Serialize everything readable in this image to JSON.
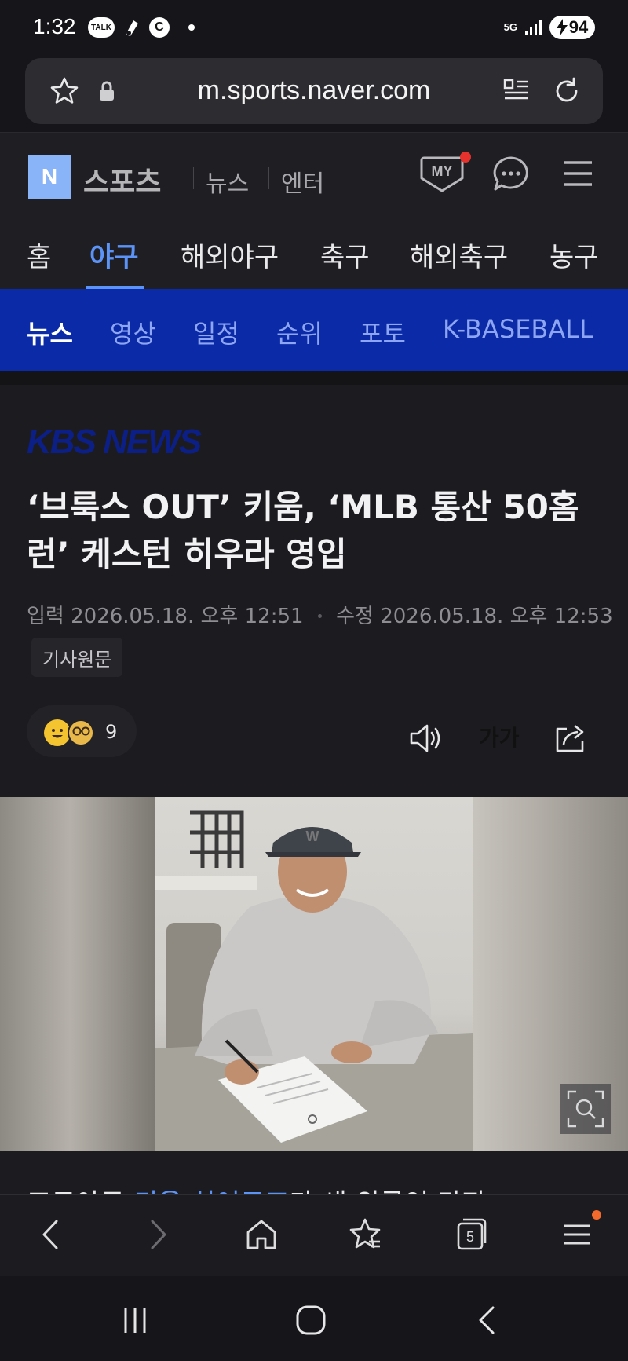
{
  "status_bar": {
    "time": "1:32",
    "talk_badge": "TALK",
    "c_badge": "C",
    "network": "5G",
    "battery": "94"
  },
  "browser": {
    "url": "m.sports.naver.com",
    "tab_count": "5"
  },
  "header": {
    "logo_letter": "N",
    "brand": "스포츠",
    "links": [
      "뉴스",
      "엔터"
    ],
    "my_label": "MY"
  },
  "sport_tabs": [
    "홈",
    "야구",
    "해외야구",
    "축구",
    "해외축구",
    "농구"
  ],
  "active_sport_tab": "야구",
  "sub_nav": [
    "뉴스",
    "영상",
    "일정",
    "순위",
    "포토",
    "K-BASEBALL"
  ],
  "active_sub_nav": "뉴스",
  "article": {
    "press": "KBS NEWS",
    "title_line1": "‘브룩스 OUT’ 키움, ‘MLB 통산 50홈",
    "title_line2": "런’ 케스턴 히우라 영입",
    "input_label": "입력",
    "input_time": "2026.05.18. 오후 12:51",
    "modified_label": "수정",
    "modified_time": "2026.05.18. 오후 12:53",
    "original_button": "기사원문",
    "reaction_count": "9",
    "font_button": "가가",
    "body_peek_prefix": "프로야구 ",
    "body_peek_link": "키움 히어로즈",
    "body_peek_suffix": "가 새 외국인 타자"
  },
  "colors": {
    "accent_blue": "#5c93f7",
    "subnav_bg": "#0b2aa8",
    "notification_red": "#e5322d",
    "menu_badge_orange": "#f36a2d"
  },
  "icons": [
    "star-icon",
    "lock-icon",
    "reader-icon",
    "reload-icon",
    "my-icon",
    "chat-icon",
    "menu-icon",
    "speaker-icon",
    "share-icon",
    "zoom-icon",
    "back-icon",
    "forward-icon",
    "home-icon",
    "bookmark-icon",
    "tabs-icon",
    "browser-menu-icon",
    "recents-icon",
    "system-home-icon",
    "system-back-icon"
  ]
}
